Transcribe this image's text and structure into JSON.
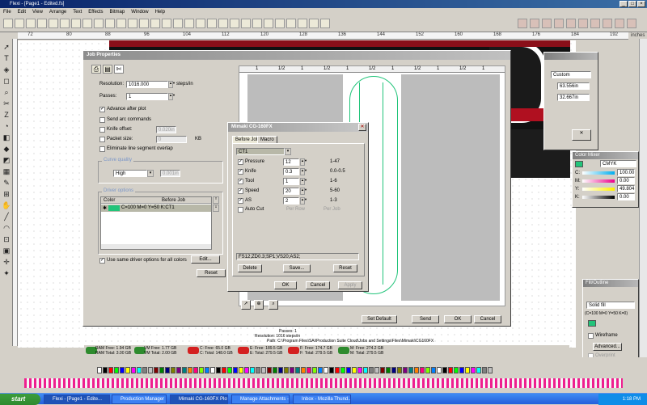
{
  "app": {
    "title": "Flexi - [Page1 - Edited.fs]"
  },
  "menu": [
    "File",
    "Edit",
    "View",
    "Arrange",
    "Text",
    "Effects",
    "Bitmap",
    "Window",
    "Help"
  ],
  "rulers": {
    "top_labels": [
      "72",
      "80",
      "88",
      "96",
      "104",
      "112",
      "120",
      "128",
      "136",
      "144",
      "152",
      "160",
      "168",
      "176",
      "184",
      "192"
    ],
    "top_unit": "inches"
  },
  "job_properties": {
    "title": "Job Properties",
    "resolution_label": "Resolution:",
    "resolution_value": "1016.000",
    "resolution_unit": "steps/in",
    "passes_label": "Passes:",
    "passes_value": "1",
    "advance_after_plot": "Advance after plot",
    "send_arc": "Send arc commands",
    "knife_offset_label": "Knife offset:",
    "knife_offset_value": "0.020in",
    "packet_size_label": "Packet size:",
    "packet_size_value": "0",
    "packet_size_unit": "KB",
    "eliminate_overlap": "Eliminate line segment overlap",
    "curve_quality_title": "Curve quality",
    "curve_quality_value": "High",
    "curve_quality_dim": "0.001in",
    "driver_options_title": "Driver options",
    "col_color": "Color",
    "col_before_job": "Before Job",
    "driver_row": "C=100 M=0 Y=50 K:CT1",
    "use_same_driver": "Use same driver options for all colors",
    "edit_button": "Edit...",
    "reset_button": "Reset",
    "set_default": "Set Default",
    "send": "Send",
    "ok": "OK",
    "cancel": "Cancel",
    "ruler_marks": [
      "1",
      "1/2",
      "1",
      "1/2",
      "1",
      "1/2",
      "1",
      "1/2",
      "1",
      "1/2",
      "1"
    ]
  },
  "mimaki": {
    "title": "Mimaki CG-160FX",
    "tabs": [
      "Before Job",
      "Macro"
    ],
    "condition": "CT1",
    "rows": [
      {
        "label": "Pressure",
        "value": "12",
        "range": "1-47"
      },
      {
        "label": "Knife",
        "value": "0.3",
        "range": "0.0-0.5"
      },
      {
        "label": "Tool",
        "value": "1",
        "range": "1-6"
      },
      {
        "label": "Speed",
        "value": "20",
        "range": "5-60"
      },
      {
        "label": "AS",
        "value": "2",
        "range": "1-3"
      }
    ],
    "auto_cut": "Auto Cut",
    "per_row": "Per Row",
    "per_job": "Per Job",
    "command": "FS12;ZD0.3;SP1;VS20;AS2;",
    "delete": "Delete",
    "save": "Save...",
    "reset": "Reset",
    "ok": "OK",
    "cancel": "Cancel",
    "apply": "Apply"
  },
  "status": {
    "ram_free": "RAM Free: 1.94 GB",
    "ram_total": "RAM Total: 3.00 GB",
    "vm_free": "VM Free: 1.77 GB",
    "vm_total": "VM Total: 2.00 GB",
    "c_free": "C: Free: 65.0 GB",
    "c_total": "C: Total: 148.0 GB",
    "e_free": "E: Free: 189.5 GB",
    "e_total": "E: Total: 279.5 GB",
    "f_free": "F: Free: 174.7 GB",
    "f_total": "F: Total: 279.5 GB",
    "m_free": "M: Free: 274.2 GB",
    "m_total": "M: Total: 279.5 GB"
  },
  "info_text": {
    "passes": "Passes: 1",
    "resolution": "Resolution: 1016 steps/in",
    "path": "Path: C:\\Program Files\\SAi\\Production Suite Cloud\\Jobs and Settings\\Files\\Mimaki\\CG160FX"
  },
  "right_panels": {
    "transform_value": "Custom",
    "width": "63.556in",
    "height": "32.667in",
    "color_title": "Color Mixer",
    "color_model": "CMYK",
    "c": "100.00",
    "m": "0.00",
    "y": "49.804",
    "k": "0.00",
    "fill_title": "Fill/Outline",
    "fill_type": "Solid fill",
    "fill_desc": "(C=100 M=0 Y=50 K=0)",
    "wireframe": "Wireframe",
    "advanced": "Advanced...",
    "overprint": "Overprint"
  },
  "taskbar": {
    "start": "start",
    "tasks": [
      "Flexi - [Page1 - Edite...",
      "Production Manager",
      "Mimaki CG-160FX Plot...",
      "Manage Attachments -...",
      "Inbox - Mozilla Thund..."
    ],
    "time": "1:18 PM"
  },
  "colors": {
    "accent_green": "#22c47a",
    "title_blue": "#0a246a",
    "disabled_title": "#9c9c9c"
  }
}
